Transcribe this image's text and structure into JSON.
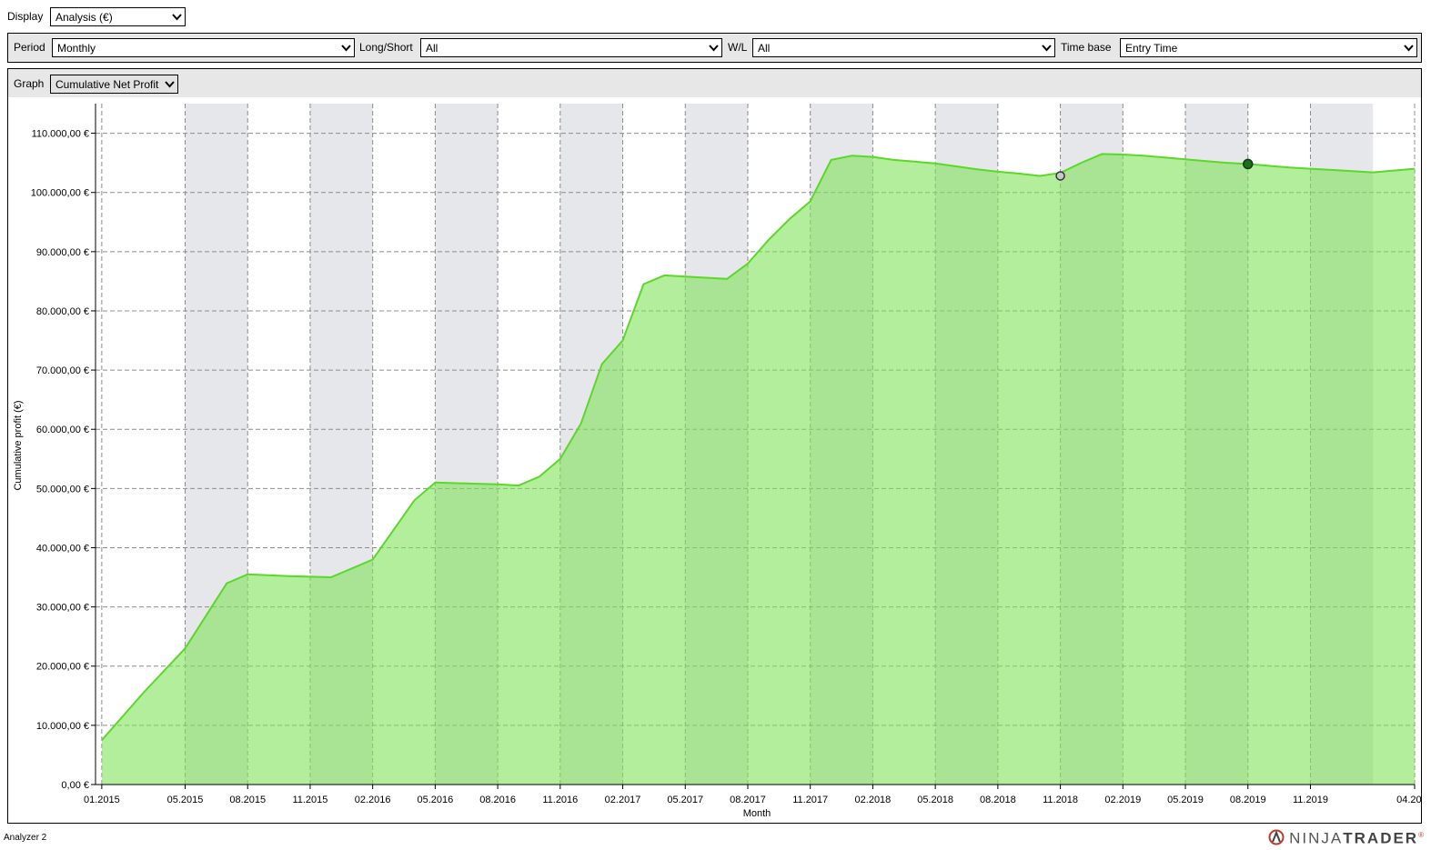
{
  "display": {
    "label": "Display",
    "value": "Analysis (€)"
  },
  "filters": {
    "period_label": "Period",
    "period_value": "Monthly",
    "longshort_label": "Long/Short",
    "longshort_value": "All",
    "wl_label": "W/L",
    "wl_value": "All",
    "timebase_label": "Time base",
    "timebase_value": "Entry Time"
  },
  "graph": {
    "label": "Graph",
    "value": "Cumulative Net Profit"
  },
  "colors": {
    "fill": "#7ee35a",
    "line": "#5ad926",
    "band": "#e6e7ea",
    "grid": "#8c8c8c"
  },
  "chart_data": {
    "type": "area",
    "ylabel": "Cumulative profit (€)",
    "xlabel": "Month",
    "ylim": [
      0,
      115000
    ],
    "y_ticks": [
      0,
      10000,
      20000,
      30000,
      40000,
      50000,
      60000,
      70000,
      80000,
      90000,
      100000,
      110000
    ],
    "y_tick_labels": [
      "0,00 €",
      "10.000,00 €",
      "20.000,00 €",
      "30.000,00 €",
      "40.000,00 €",
      "50.000,00 €",
      "60.000,00 €",
      "70.000,00 €",
      "80.000,00 €",
      "90.000,00 €",
      "100.000,00 €",
      "110.000,00 €"
    ],
    "x_tick_labels": [
      "01.2015",
      "05.2015",
      "08.2015",
      "11.2015",
      "02.2016",
      "05.2016",
      "08.2016",
      "11.2016",
      "02.2017",
      "05.2017",
      "08.2017",
      "11.2017",
      "02.2018",
      "05.2018",
      "08.2018",
      "11.2018",
      "02.2019",
      "05.2019",
      "08.2019",
      "11.2019",
      "04.2020"
    ],
    "x_tick_months": [
      0,
      4,
      7,
      10,
      13,
      16,
      19,
      22,
      25,
      28,
      31,
      34,
      37,
      40,
      43,
      46,
      49,
      52,
      55,
      58,
      63
    ],
    "grid": true,
    "series": [
      {
        "months": [
          0,
          2,
          4,
          6,
          7,
          9,
          11,
          12,
          13,
          14,
          15,
          16,
          17,
          18,
          19,
          20,
          21,
          22,
          23,
          24,
          25,
          26,
          27,
          28,
          29,
          30,
          31,
          32,
          33,
          34,
          35,
          36,
          37,
          38,
          39,
          40,
          41,
          42,
          43,
          44,
          45,
          46,
          47,
          48,
          49,
          50,
          51,
          52,
          53,
          54,
          55,
          56,
          57,
          58,
          59,
          60,
          61,
          62,
          63
        ],
        "values": [
          7500,
          15500,
          23000,
          34000,
          35500,
          35200,
          35000,
          36500,
          38000,
          43000,
          48000,
          51000,
          50900,
          50800,
          50700,
          50500,
          52000,
          55000,
          61000,
          71000,
          75000,
          84500,
          86000,
          85800,
          85600,
          85400,
          88000,
          92000,
          95500,
          98500,
          105500,
          106200,
          106000,
          105500,
          105200,
          104900,
          104400,
          103900,
          103500,
          103200,
          102800,
          103300,
          105000,
          106500,
          106400,
          106200,
          105900,
          105600,
          105300,
          105000,
          104800,
          104500,
          104200,
          104000,
          103800,
          103600,
          103400,
          103700,
          104000
        ]
      }
    ],
    "markers": [
      {
        "month": 46,
        "value": 102800,
        "style": "hollow"
      },
      {
        "month": 55,
        "value": 104800,
        "style": "filled"
      }
    ]
  },
  "footer": {
    "left": "Analyzer 2",
    "logo_a": "NINJA",
    "logo_b": "TRADER",
    "logo_mark": "®"
  }
}
